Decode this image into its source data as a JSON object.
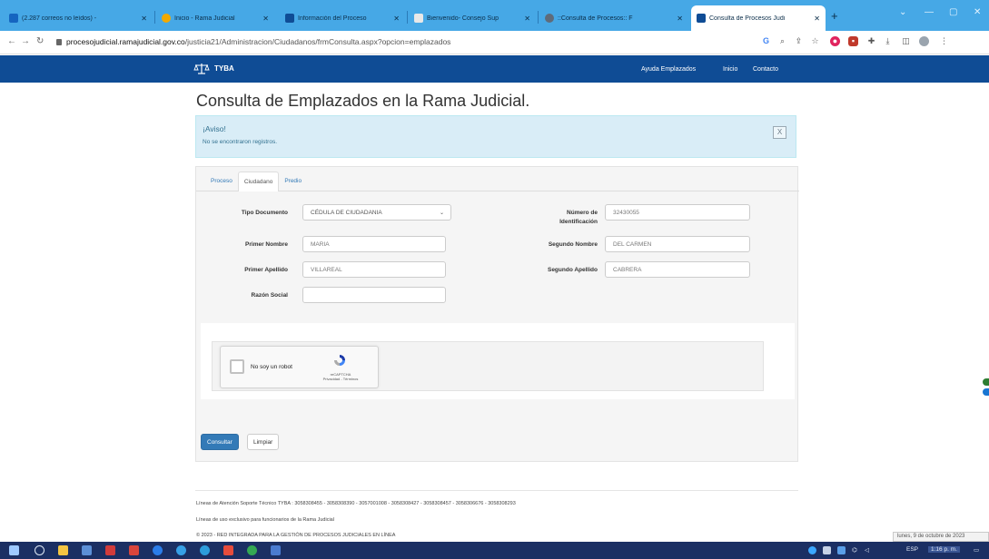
{
  "browser": {
    "tabs": [
      {
        "label": "(2.287 correos no leídos) -",
        "favicon": "mail-icon",
        "color": "#1565c0"
      },
      {
        "label": "Inicio - Rama Judicial",
        "favicon": "rama-judicial-icon",
        "color": "#f2a900"
      },
      {
        "label": "Información del Proceso",
        "favicon": "tyba-icon",
        "color": "#0f4c95"
      },
      {
        "label": "Bienvenido- Consejo Sup",
        "favicon": "document-icon",
        "color": "#e8e8e8"
      },
      {
        "label": "::Consulta de Procesos:: F",
        "favicon": "globe-icon",
        "color": "#5f6b7a"
      },
      {
        "label": "Consulta de Procesos Judi",
        "favicon": "tyba-icon",
        "color": "#0f4c95"
      }
    ],
    "url_domain": "procesojudicial.ramajudicial.gov.co",
    "url_path": "/justicia21/Administracion/Ciudadanos/frmConsulta.aspx?opcion=emplazados"
  },
  "site": {
    "brand": "TYBA",
    "nav": [
      "Ayuda Emplazados",
      "Inicio",
      "Contacto"
    ]
  },
  "page": {
    "title": "Consulta de Emplazados en la Rama Judicial.",
    "alert": {
      "heading": "¡Aviso!",
      "body": "No se encontraron registros.",
      "close": "X"
    },
    "tabs": [
      "Proceso",
      "Ciudadano",
      "Predio"
    ],
    "form": {
      "tipo_documento": {
        "label": "Tipo Documento",
        "value": "CÉDULA DE CIUDADANIA"
      },
      "numero_identificacion": {
        "label1": "Número de",
        "label2": "Identificación",
        "value": "32430055"
      },
      "primer_nombre": {
        "label": "Primer Nombre",
        "value": "MARIA"
      },
      "segundo_nombre": {
        "label": "Segundo Nombre",
        "value": "DEL CARMEN"
      },
      "primer_apellido": {
        "label": "Primer Apellido",
        "value": "VILLAREAL"
      },
      "segundo_apellido": {
        "label": "Segundo Apellido",
        "value": "CABRERA"
      },
      "razon_social": {
        "label": "Razón Social",
        "value": ""
      }
    },
    "captcha": {
      "text": "No soy un robot",
      "brand": "reCAPTCHA",
      "links": "Privacidad - Términos"
    },
    "buttons": {
      "consultar": "Consultar",
      "limpiar": "Limpiar"
    }
  },
  "footer": {
    "line1": "Líneas de Atención Soporte Técnico TYBA : 3058308455 - 3058308390 - 3057001008 - 3058308427 - 3058308457 - 3058306676 - 3058308293",
    "line2": "Líneas de uso exclusivo para funcionarios de la Rama Judicial",
    "line3": "© 2023 - RED INTEGRADA PARA LA GESTIÓN DE PROCESOS JUDICIALES EN LÍNEA"
  },
  "taskbar": {
    "language": "ESP",
    "time": "1:16 p. m.",
    "date_tooltip": "lunes, 9 de octubre de 2023"
  }
}
